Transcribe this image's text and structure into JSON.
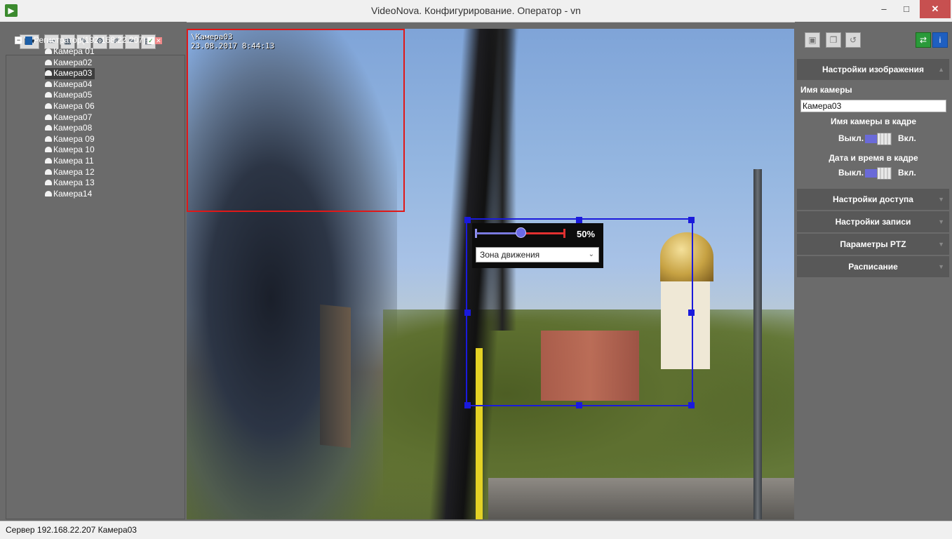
{
  "window": {
    "title": "VideoNova. Конфигурирование. Оператор - vn",
    "app_icon": "videonova-app-icon",
    "minimize": "–",
    "maximize": "□",
    "close": "✕"
  },
  "left_toolbar": {
    "icons": [
      "server-select-icon",
      "monitor-icon",
      "layout-icon",
      "tools-icon",
      "settings-icon",
      "zone-edit-icon",
      "draw-icon",
      "grid-icon"
    ]
  },
  "tree": {
    "root": "Регистратор(192.168.22.207)",
    "root_status": [
      "connected-check-icon",
      "remove-x-icon"
    ],
    "cameras": [
      "Камера 01",
      "Камера02",
      "Камера03",
      "Камера04",
      "Камера05",
      "Камера 06",
      "Камера07",
      "Камера08",
      "Камера 09",
      "Камера 10",
      "Камера 11",
      "Камера 12",
      "Камера 13",
      "Камера14"
    ],
    "selected_index": 2
  },
  "video": {
    "osd_name": "\\Камера03",
    "osd_datetime": "23.08.2017 8:44:13"
  },
  "motion_zone": {
    "sensitivity_pct": 50,
    "sensitivity_label": "50%",
    "zone_type": "Зона движения"
  },
  "right_panel": {
    "toolbar_icons": [
      "save-icon",
      "copy-icon",
      "undo-icon",
      "sync-icon",
      "info-icon"
    ],
    "section_image": "Настройки изображения",
    "camera_name_label": "Имя камеры",
    "camera_name_value": "Камера03",
    "name_in_frame_label": "Имя камеры в кадре",
    "datetime_in_frame_label": "Дата и время в кадре",
    "toggle_off": "Выкл.",
    "toggle_on": "Вкл.",
    "name_in_frame_on": false,
    "datetime_in_frame_on": false,
    "sections": [
      "Настройки доступа",
      "Настройки записи",
      "Параметры PTZ",
      "Расписание"
    ]
  },
  "status": "Сервер 192.168.22.207 Камера03",
  "colors": {
    "zone_red": "#e01818",
    "zone_blue": "#1a1adc",
    "panel_bg": "#6b6b6b"
  }
}
